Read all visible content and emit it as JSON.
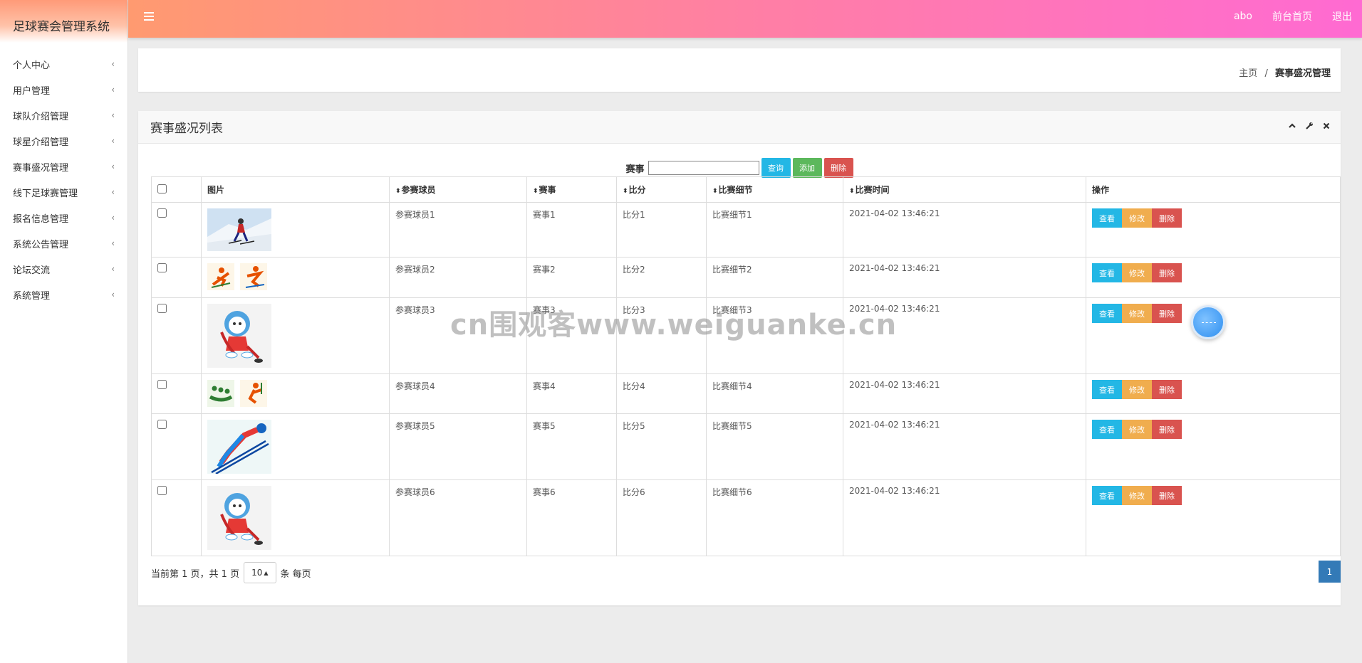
{
  "brand": {
    "title": "足球赛会管理系统"
  },
  "sidebar": {
    "items": [
      {
        "label": "个人中心"
      },
      {
        "label": "用户管理"
      },
      {
        "label": "球队介绍管理"
      },
      {
        "label": "球星介绍管理"
      },
      {
        "label": "赛事盛况管理"
      },
      {
        "label": "线下足球赛管理"
      },
      {
        "label": "报名信息管理"
      },
      {
        "label": "系统公告管理"
      },
      {
        "label": "论坛交流"
      },
      {
        "label": "系统管理"
      }
    ]
  },
  "header": {
    "user": "abo",
    "home_link": "前台首页",
    "logout": "退出"
  },
  "breadcrumb": {
    "home": "主页",
    "sep": "/",
    "current": "赛事盛况管理"
  },
  "panel": {
    "title": "赛事盛况列表",
    "icons": [
      "chevron-up-icon",
      "wrench-icon",
      "close-icon"
    ]
  },
  "search": {
    "label": "赛事",
    "value": "",
    "query_btn": "查询",
    "add_btn": "添加",
    "delete_btn": "删除"
  },
  "table": {
    "headers": {
      "image": "图片",
      "player": "参赛球员",
      "event": "赛事",
      "score": "比分",
      "detail": "比赛细节",
      "time": "比赛时间",
      "ops": "操作"
    },
    "rows": [
      {
        "player": "参赛球员1",
        "event": "赛事1",
        "score": "比分1",
        "detail": "比赛细节1",
        "time": "2021-04-02 13:46:21",
        "image": "skier-photo"
      },
      {
        "player": "参赛球员2",
        "event": "赛事2",
        "score": "比分2",
        "detail": "比赛细节2",
        "time": "2021-04-02 13:46:21",
        "image": "winter-sport-pictograms"
      },
      {
        "player": "参赛球员3",
        "event": "赛事3",
        "score": "比分3",
        "detail": "比赛细节3",
        "time": "2021-04-02 13:46:21",
        "image": "hockey-mascot"
      },
      {
        "player": "参赛球员4",
        "event": "赛事4",
        "score": "比分4",
        "detail": "比赛细节4",
        "time": "2021-04-02 13:46:21",
        "image": "bobsled-pictograms"
      },
      {
        "player": "参赛球员5",
        "event": "赛事5",
        "score": "比分5",
        "detail": "比赛细节5",
        "time": "2021-04-02 13:46:21",
        "image": "ski-jump-illustration"
      },
      {
        "player": "参赛球员6",
        "event": "赛事6",
        "score": "比分6",
        "detail": "比赛细节6",
        "time": "2021-04-02 13:46:21",
        "image": "hockey-mascot"
      }
    ],
    "op_view": "查看",
    "op_edit": "修改",
    "op_delete": "删除"
  },
  "pagination": {
    "info": "当前第 1 页，共 1 页",
    "page_size": "10",
    "per_page": "条 每页",
    "current_page": "1"
  },
  "watermark": "cn围观客www.weiguanke.cn",
  "colors": {
    "topbar_start": "#ff9a70",
    "topbar_end": "#ff6ad2",
    "btn_view": "#23b7e5",
    "btn_edit": "#f0ad4e",
    "btn_delete": "#d9534f",
    "btn_add": "#5cb85c",
    "page_active": "#337ab7"
  }
}
